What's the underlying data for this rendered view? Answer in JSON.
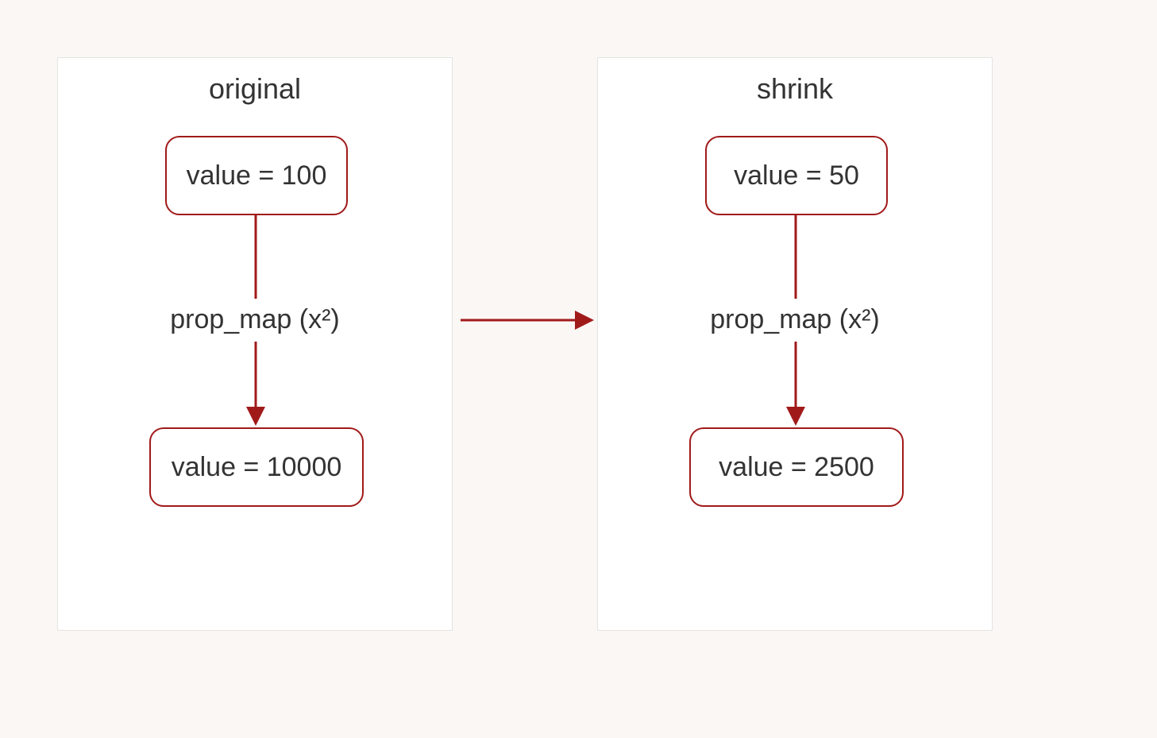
{
  "colors": {
    "accent": "#a11a1a",
    "panelBorder": "#e3e3e3",
    "bg": "#faf7f5",
    "text": "#333333"
  },
  "left": {
    "title": "original",
    "top_value": "value = 100",
    "map_label": "prop_map (x²)",
    "bottom_value": "value = 10000"
  },
  "right": {
    "title": "shrink",
    "top_value": "value = 50",
    "map_label": "prop_map (x²)",
    "bottom_value": "value = 2500"
  }
}
